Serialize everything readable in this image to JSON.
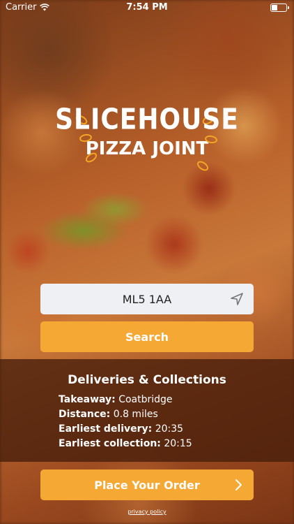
{
  "status_bar": {
    "carrier": "Carrier",
    "time": "7:54 PM",
    "wifi_icon": "wifi-icon",
    "battery_icon": "battery-icon"
  },
  "logo": {
    "line1": "SLICEHOUSE",
    "line2": "PIZZA JOINT"
  },
  "search": {
    "postcode_value": "ML5 1AA",
    "location_icon": "location-arrow-icon",
    "button_label": "Search"
  },
  "info_panel": {
    "title": "Deliveries & Collections",
    "rows": [
      {
        "label": "Takeaway:",
        "value": "Coatbridge"
      },
      {
        "label": "Distance:",
        "value": "0.8 miles"
      },
      {
        "label": "Earliest delivery:",
        "value": "20:35"
      },
      {
        "label": "Earliest collection:",
        "value": "20:15"
      }
    ]
  },
  "order": {
    "button_label": "Place Your Order",
    "chevron_icon": "chevron-right-icon"
  },
  "footer": {
    "privacy_link": "privacy policy"
  },
  "colors": {
    "accent": "#f6a834",
    "input_bg": "#eef0f4",
    "panel_bg": "rgba(70,30,10,0.78)"
  }
}
